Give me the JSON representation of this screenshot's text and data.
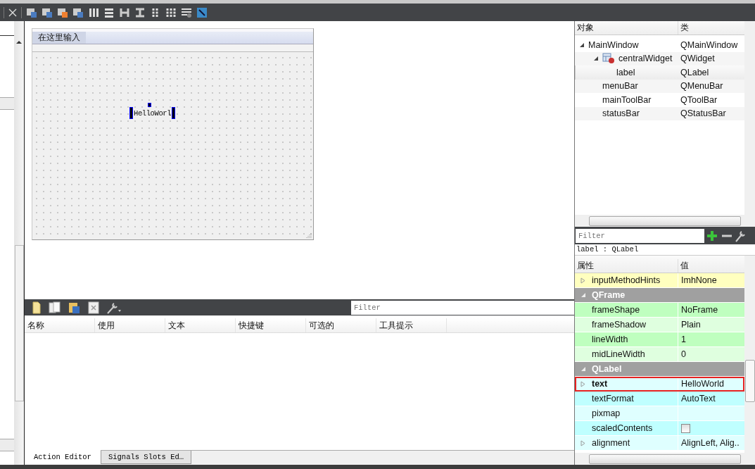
{
  "form": {
    "menu_placeholder": "在这里输入",
    "label_text": "HelloWorl"
  },
  "action_editor": {
    "filter": {
      "placeholder": "Filter"
    },
    "columns": [
      "名称",
      "使用",
      "文本",
      "快捷键",
      "可选的",
      "工具提示"
    ],
    "tabs": [
      {
        "label": "Action Editor",
        "selected": true
      },
      {
        "label": "Signals  Slots Ed…",
        "selected": false
      }
    ]
  },
  "object_inspector": {
    "columns": [
      "对象",
      "类"
    ],
    "tree": [
      {
        "name": "MainWindow",
        "class": "QMainWindow",
        "selected": false,
        "expanded": true,
        "children": [
          {
            "name": "centralWidget",
            "class": "QWidget",
            "selected": false,
            "expanded": true,
            "children": [
              {
                "name": "label",
                "class": "QLabel",
                "selected": true
              }
            ]
          },
          {
            "name": "menuBar",
            "class": "QMenuBar",
            "selected": false
          },
          {
            "name": "mainToolBar",
            "class": "QToolBar",
            "selected": false
          },
          {
            "name": "statusBar",
            "class": "QStatusBar",
            "selected": false
          }
        ]
      }
    ]
  },
  "property_editor": {
    "filter": {
      "placeholder": "Filter"
    },
    "object": "label : QLabel",
    "columns": [
      "属性",
      "值"
    ],
    "rows": [
      {
        "kind": "property",
        "name": "inputMethodHints",
        "value": "ImhNone",
        "expandable": true,
        "modified": false,
        "highlighted": false,
        "color": "#ffffbf"
      },
      {
        "kind": "group",
        "name": "QFrame",
        "expanded": true,
        "color": "#a0a0a0"
      },
      {
        "kind": "property",
        "name": "frameShape",
        "value": "NoFrame",
        "expandable": false,
        "modified": false,
        "highlighted": false,
        "color": "#bfffbf"
      },
      {
        "kind": "property",
        "name": "frameShadow",
        "value": "Plain",
        "expandable": false,
        "modified": false,
        "highlighted": false,
        "color": "#dfffdf"
      },
      {
        "kind": "property",
        "name": "lineWidth",
        "value": "1",
        "expandable": false,
        "modified": false,
        "highlighted": false,
        "color": "#bfffbf"
      },
      {
        "kind": "property",
        "name": "midLineWidth",
        "value": "0",
        "expandable": false,
        "modified": false,
        "highlighted": false,
        "color": "#dfffdf"
      },
      {
        "kind": "group",
        "name": "QLabel",
        "expanded": true,
        "color": "#a0a0a0"
      },
      {
        "kind": "property",
        "name": "text",
        "value": "HelloWorld",
        "expandable": true,
        "modified": true,
        "highlighted": true,
        "color": "#dfffff"
      },
      {
        "kind": "property",
        "name": "textFormat",
        "value": "AutoText",
        "expandable": false,
        "modified": false,
        "highlighted": false,
        "color": "#bfffff"
      },
      {
        "kind": "property",
        "name": "pixmap",
        "value": "",
        "expandable": false,
        "modified": false,
        "highlighted": false,
        "color": "#dfffff"
      },
      {
        "kind": "checkbox",
        "name": "scaledContents",
        "checked": false,
        "color": "#bfffff"
      },
      {
        "kind": "property",
        "name": "alignment",
        "value": "AlignLeft, Alig..",
        "expandable": true,
        "modified": false,
        "highlighted": false,
        "color": "#dfffff"
      }
    ]
  }
}
